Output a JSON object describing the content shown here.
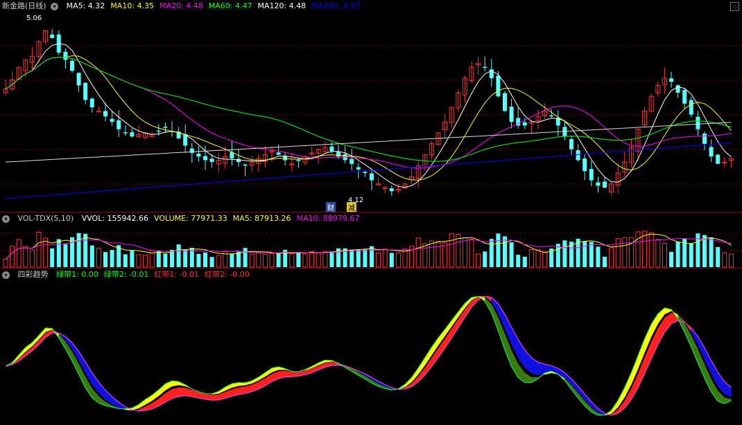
{
  "price_panel": {
    "title": "新金路",
    "period": "(日线)",
    "indicators": [
      {
        "label": "MA5: 4.32",
        "color": "#ffffff"
      },
      {
        "label": "MA10: 4.35",
        "color": "#ffff00"
      },
      {
        "label": "MA20: 4.48",
        "color": "#ff00ff"
      },
      {
        "label": "MA60: 4.47",
        "color": "#00ff00"
      },
      {
        "label": "MA120: 4.48",
        "color": "#ffffff"
      },
      {
        "label": "MA250: 4.37",
        "color": "#0000ff"
      }
    ],
    "high_label": "5.06",
    "low_label": "4.12",
    "marks": [
      "财",
      "减"
    ]
  },
  "volume_panel": {
    "title": "VOL-TDX(5,10)",
    "items": [
      {
        "label": "VVOL: 155942.66",
        "color": "#ffffff"
      },
      {
        "label": "VOLUME: 77971.33",
        "color": "#ffff00"
      },
      {
        "label": "MA5: 87913.26",
        "color": "#ffff00"
      },
      {
        "label": "MA10: 88979.67",
        "color": "#ff00ff"
      }
    ]
  },
  "trend_panel": {
    "title": "四彩趋势",
    "items": [
      {
        "label": "绿带1: 0.00",
        "color": "#00ff00"
      },
      {
        "label": "绿带2: -0.01",
        "color": "#00ff00"
      },
      {
        "label": "红带1: -0.01",
        "color": "#ff3333"
      },
      {
        "label": "红带2: -0.00",
        "color": "#ff3333"
      }
    ]
  },
  "colors": {
    "up": "#ff3333",
    "down": "#55ffff",
    "grid": "#8b0000",
    "ma5": "#ffffff",
    "ma10": "#ffff00",
    "ma20": "#ff00ff",
    "ma60": "#00ff00",
    "ma120": "#ffffff",
    "ma250": "#0000ff"
  },
  "chart_data": {
    "type": "line",
    "closes": [
      4.7,
      4.75,
      4.82,
      4.86,
      4.88,
      4.96,
      5.02,
      4.98,
      4.9,
      4.86,
      4.8,
      4.72,
      4.64,
      4.6,
      4.58,
      4.55,
      4.52,
      4.48,
      4.46,
      4.44,
      4.45,
      4.46,
      4.45,
      4.47,
      4.49,
      4.47,
      4.43,
      4.39,
      4.35,
      4.33,
      4.31,
      4.3,
      4.31,
      4.33,
      4.32,
      4.3,
      4.28,
      4.3,
      4.32,
      4.34,
      4.36,
      4.34,
      4.31,
      4.29,
      4.31,
      4.33,
      4.35,
      4.37,
      4.38,
      4.36,
      4.33,
      4.31,
      4.29,
      4.26,
      4.24,
      4.2,
      4.18,
      4.16,
      4.14,
      4.15,
      4.18,
      4.22,
      4.28,
      4.34,
      4.4,
      4.46,
      4.52,
      4.6,
      4.68,
      4.76,
      4.82,
      4.84,
      4.82,
      4.76,
      4.66,
      4.58,
      4.52,
      4.5,
      4.5,
      4.52,
      4.55,
      4.58,
      4.55,
      4.5,
      4.44,
      4.37,
      4.31,
      4.25,
      4.2,
      4.17,
      4.16,
      4.18,
      4.24,
      4.3,
      4.38,
      4.48,
      4.58,
      4.66,
      4.72,
      4.76,
      4.74,
      4.68,
      4.62,
      4.56,
      4.48,
      4.4,
      4.33,
      4.29,
      4.3,
      4.32
    ],
    "ylim": [
      4.05,
      5.12
    ]
  }
}
